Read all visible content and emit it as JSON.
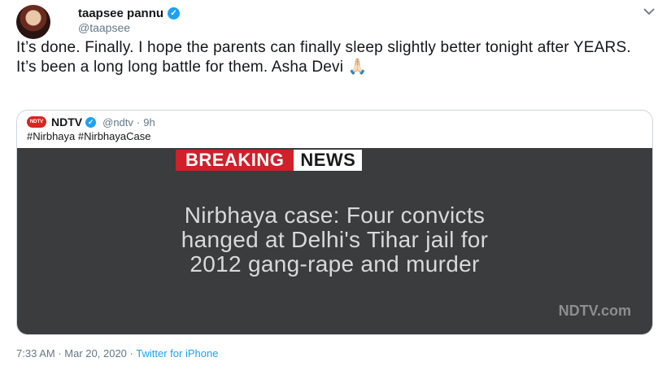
{
  "author": {
    "display_name": "taapsee pannu",
    "handle": "@taapsee",
    "verified_glyph": "✓"
  },
  "tweet": {
    "text": "It’s done. Finally. I hope the parents can finally sleep slightly better tonight after YEARS. It’s been a long long battle for them. Asha Devi 🙏🏻"
  },
  "quote": {
    "logo_text": "NDTV",
    "name": "NDTV",
    "verified_glyph": "✓",
    "handle": "@ndtv",
    "separator": "·",
    "time": "9h",
    "hashtags": "#Nirbhaya #NirbhayaCase",
    "media": {
      "badge_left": "BREAKING",
      "badge_right": "NEWS",
      "headline_lines": [
        "Nirbhaya case: Four convicts",
        "hanged at Delhi's Tihar jail for",
        "2012 gang-rape and murder"
      ],
      "watermark": "NDTV.com"
    }
  },
  "footer": {
    "time": "7:33 AM",
    "sep1": "·",
    "date": "Mar 20, 2020",
    "sep2": "·",
    "source": "Twitter for iPhone"
  },
  "icons": {
    "more": "chevron-down-icon"
  }
}
